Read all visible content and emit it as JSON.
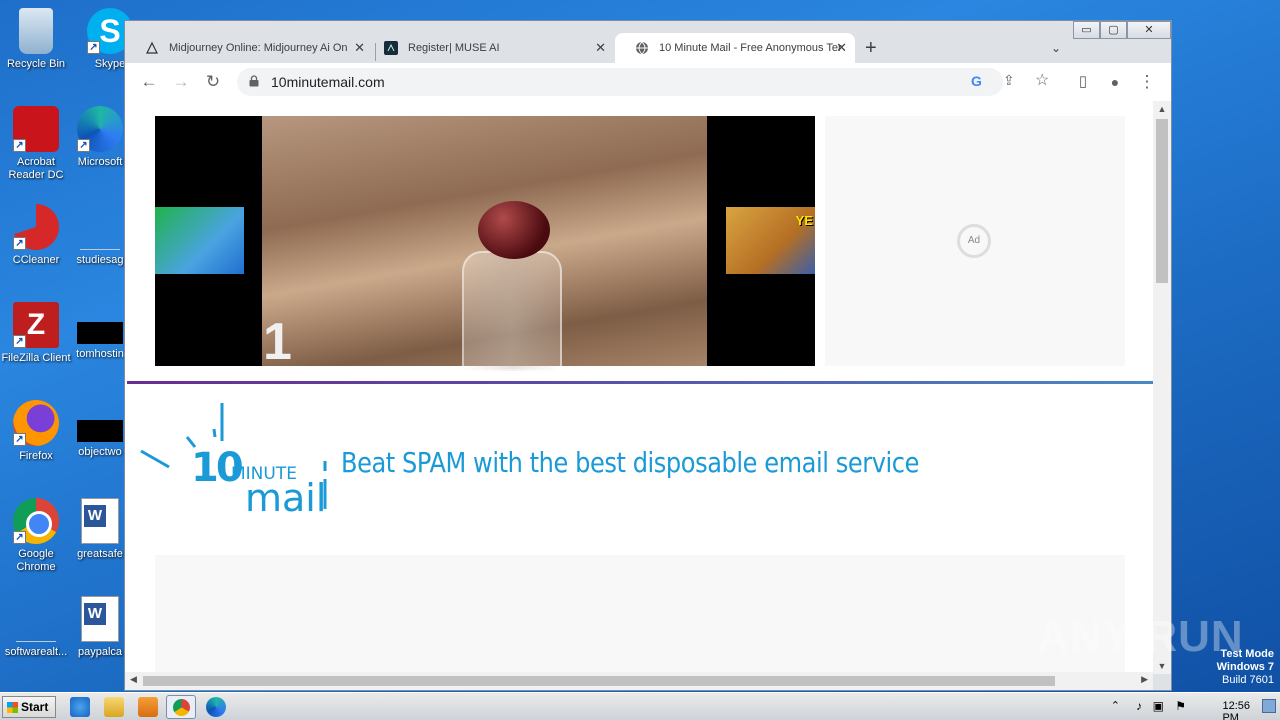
{
  "desktop": {
    "icons": [
      {
        "name": "recycle-bin",
        "label": "Recycle Bin"
      },
      {
        "name": "skype",
        "label": "Skype"
      },
      {
        "name": "acrobat-reader",
        "label": "Acrobat Reader DC"
      },
      {
        "name": "microsoft-edge",
        "label": "Microsoft"
      },
      {
        "name": "ccleaner",
        "label": "CCleaner"
      },
      {
        "name": "studiesag",
        "label": "studiesag"
      },
      {
        "name": "filezilla",
        "label": "FileZilla Client"
      },
      {
        "name": "tomhosting",
        "label": "tomhostin"
      },
      {
        "name": "firefox",
        "label": "Firefox"
      },
      {
        "name": "objectwo",
        "label": "objectwo"
      },
      {
        "name": "google-chrome",
        "label": "Google Chrome"
      },
      {
        "name": "greatsafe",
        "label": "greatsafe"
      },
      {
        "name": "softwarealt",
        "label": "softwarealt..."
      },
      {
        "name": "paypalca",
        "label": "paypalca"
      }
    ]
  },
  "browser": {
    "tabs": [
      {
        "title": "Midjourney Online: Midjourney Ai On",
        "close": "✕"
      },
      {
        "title": "Register| MUSE AI",
        "close": "✕"
      },
      {
        "title": "10 Minute Mail - Free Anonymous Ter",
        "close": "✕"
      }
    ],
    "new_tab": "+",
    "tab_search": "⌄",
    "window_controls": {
      "minimize": "▭",
      "maximize": "▢",
      "close": "✕"
    },
    "back": "←",
    "forward": "→",
    "reload": "↻",
    "url": "10minutemail.com",
    "google_icon": "G",
    "share_icon": "⇪",
    "star_icon": "☆",
    "sidepanel_icon": "▯",
    "profile_icon": "●",
    "menu_icon": "⋮"
  },
  "page": {
    "video_number": "1",
    "thumb_right_text": "YE",
    "ad_label": "Ad",
    "logo_number": "10",
    "logo_minute": "MINUTE",
    "logo_mail": "mail",
    "tagline": "Beat SPAM with the best disposable email service",
    "accent_color": "#1a9ad6"
  },
  "taskbar": {
    "start_label": "Start",
    "clock": "12:56 PM"
  },
  "overlay": {
    "watermark": "ANY RUN",
    "test_mode": "Test Mode",
    "os": "Windows 7",
    "build": "Build 7601"
  }
}
